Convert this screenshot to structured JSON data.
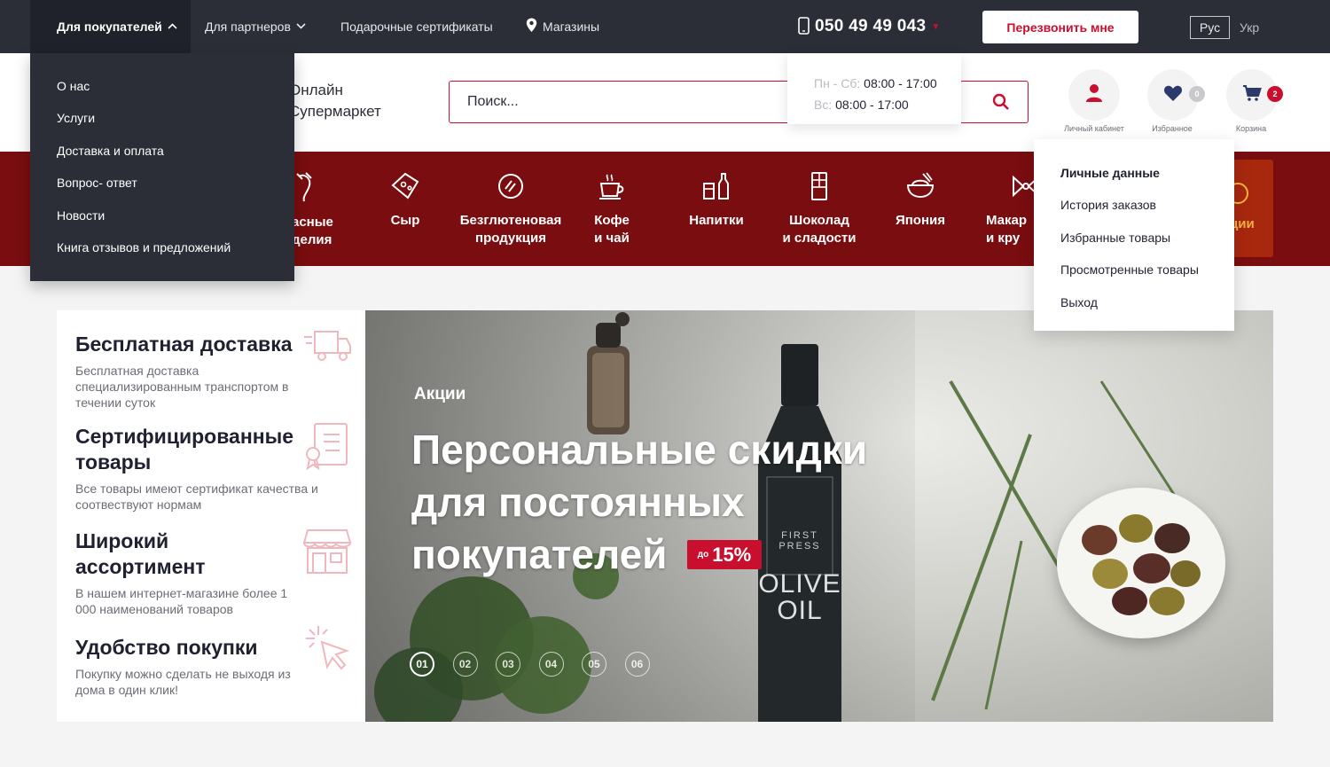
{
  "topbar": {
    "nav": [
      {
        "label": "Для покупателей",
        "chevron": "up",
        "active": true
      },
      {
        "label": "Для партнеров",
        "chevron": "down",
        "active": false
      },
      {
        "label": "Подарочные сертификаты"
      },
      {
        "label": "Магазины",
        "icon": "map-pin-icon"
      }
    ],
    "phone": "050 49 49 043",
    "callback_label": "Перезвонить мне",
    "languages": [
      "Рус",
      "Укр"
    ],
    "selected_language": "Рус"
  },
  "hours": {
    "weekday_label": "Пн - Сб:",
    "weekday_time": "08:00 - 17:00",
    "sunday_label": "Вс:",
    "sunday_time": "08:00 - 17:00"
  },
  "header": {
    "brand_line1": "Онлайн",
    "brand_line2": "Супермаркет",
    "search_placeholder": "Поиск...",
    "account_label": "Личный кабинет",
    "favorites_label": "Избранное",
    "favorites_count": "0",
    "cart_label": "Корзина",
    "cart_count": "2"
  },
  "buyers_menu": [
    "О нас",
    "Услуги",
    "Доставка и оплата",
    "Вопрос- ответ",
    "Новости",
    "Книга отзывов и предложений"
  ],
  "account_menu": [
    "Личные данные",
    "История заказов",
    "Избранные товары",
    "Просмотренные товары",
    "Выход"
  ],
  "categories": [
    {
      "line1": "асные",
      "line2": "делия",
      "icon": "sausage-icon"
    },
    {
      "line1": "Сыр",
      "line2": "",
      "icon": "cheese-icon"
    },
    {
      "line1": "Безглютеновая",
      "line2": "продукция",
      "icon": "bread-icon"
    },
    {
      "line1": "Кофе",
      "line2": "и чай",
      "icon": "coffee-cup-icon"
    },
    {
      "line1": "Напитки",
      "line2": "",
      "icon": "bottles-icon"
    },
    {
      "line1": "Шоколад",
      "line2": "и сладости",
      "icon": "chocolate-icon"
    },
    {
      "line1": "Япония",
      "line2": "",
      "icon": "rice-bowl-icon"
    },
    {
      "line1": "Макар",
      "line2": "и кру",
      "icon": "pasta-icon"
    },
    {
      "line1": "ции",
      "line2": "",
      "icon": "promo-icon"
    }
  ],
  "features": [
    {
      "title": "Бесплатная доставка",
      "text": "Бесплатная доставка специализированным транспортом в течении суток",
      "icon": "delivery-truck-icon"
    },
    {
      "title": "Сертифицированные товары",
      "text": "Все товары имеют сертификат качества и соотвествуют нормам",
      "icon": "certificate-icon"
    },
    {
      "title": "Широкий ассортимент",
      "text": "В нашем интернет-магазине более 1 000 наименований товаров",
      "icon": "store-icon"
    },
    {
      "title": "Удобство покупки",
      "text": "Покупку можно сделать не выходя из дома в один клик!",
      "icon": "cursor-click-icon"
    }
  ],
  "banner": {
    "tag": "Акции",
    "headline_line1": "Персональные скидки",
    "headline_line2": "для постоянных",
    "headline_line3": "покупателей",
    "discount_prefix": "до",
    "discount_value": "15%",
    "bottle_label_small1": "FIRST",
    "bottle_label_small2": "PRESS",
    "bottle_label_big1": "OLIVE",
    "bottle_label_big2": "OIL",
    "slides": [
      "01",
      "02",
      "03",
      "04",
      "05",
      "06"
    ],
    "active_slide": "01"
  },
  "colors": {
    "accent_red": "#c8102e",
    "topbar_bg": "#2b2e37",
    "category_bg": "#7a0d0f"
  }
}
